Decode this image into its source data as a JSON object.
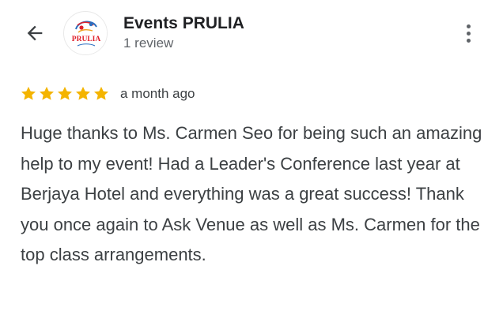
{
  "review": {
    "author": "Events PRULIA",
    "review_count": "1 review",
    "avatar_logo_text": "PRULIA",
    "rating": 5,
    "max_rating": 5,
    "date": "a month ago",
    "text": "Huge thanks to Ms. Carmen Seo for being such an amazing help to my event! Had a Leader's Conference last year at Berjaya Hotel and everything was a great success! Thank you once again to Ask Venue as well as Ms. Carmen for the top class arrangements."
  },
  "icons": {
    "back": "arrow-back-icon",
    "more": "more-vert-icon",
    "star": "star-icon"
  },
  "colors": {
    "star": "#f4b400",
    "text": "#3c4043",
    "name": "#202124",
    "muted": "#5f6368",
    "logo_red": "#e0202a",
    "logo_blue": "#2a6fc0"
  }
}
